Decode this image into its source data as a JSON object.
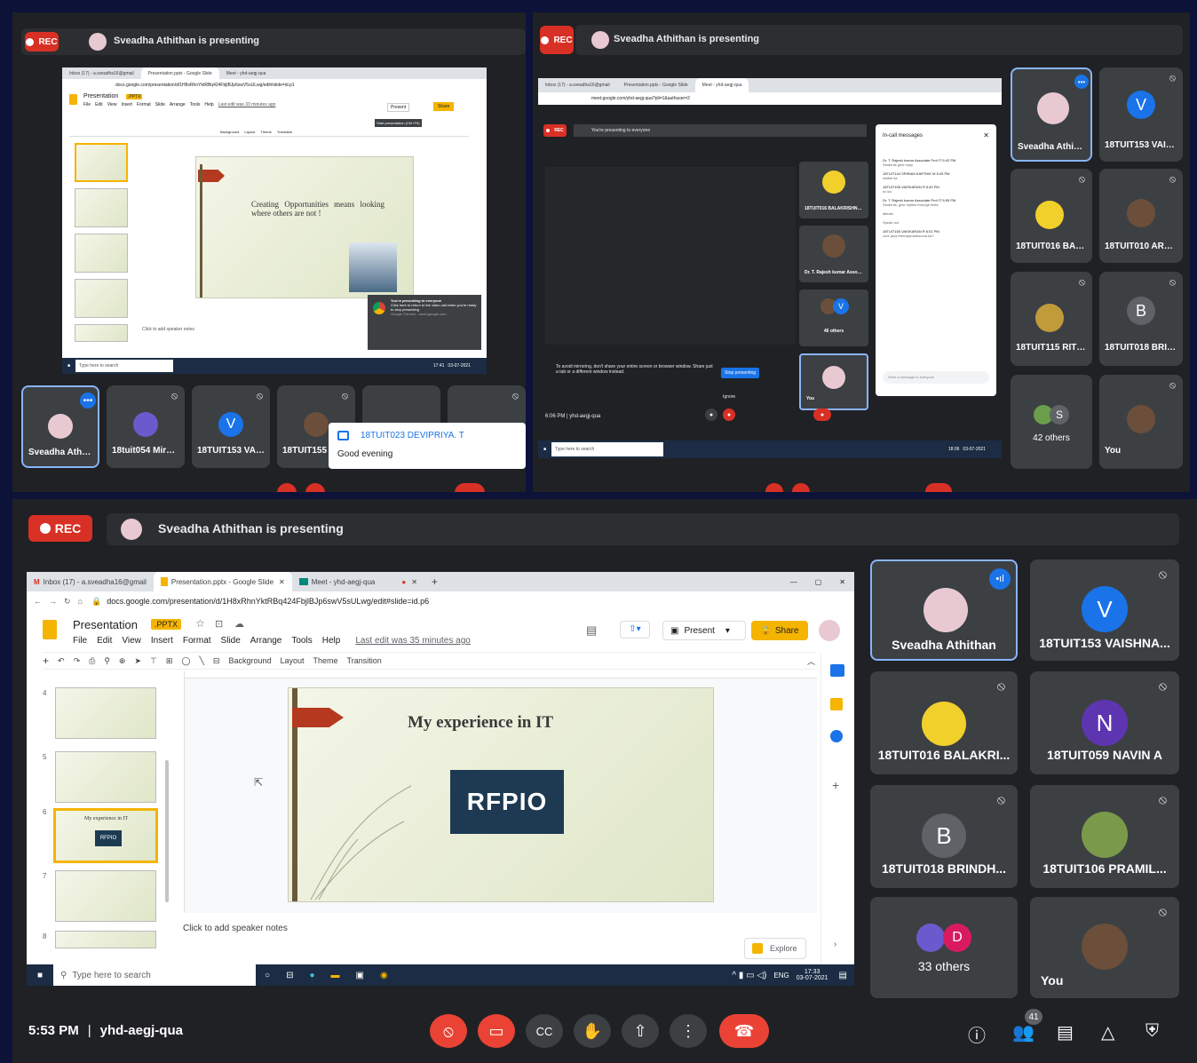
{
  "top_left": {
    "rec_label": "REC",
    "presenting_text": "Sveadha Athithan is presenting",
    "browser": {
      "tabs": [
        "Inbox (17) - a.sveadha16@gmail",
        "Presentation.pptx - Google Slide",
        "Meet - yhd-aegj-qua"
      ],
      "url": "docs.google.com/presentation/d/1H8xRhnYktRBq424FbjlBJp6swV5sULwg/edit#slide=id.p1",
      "doc_title": "Presentation",
      "badge": ".PPTX",
      "menus": [
        "File",
        "Edit",
        "View",
        "Insert",
        "Format",
        "Slide",
        "Arrange",
        "Tools",
        "Help"
      ],
      "last_edit": "Last edit was 33 minutes ago",
      "present_label": "Present",
      "share_label": "Share",
      "tooltip": "Start presentation (Ctrl+F5)",
      "toolbar_items": [
        "Background",
        "Layout",
        "Theme",
        "Transition"
      ],
      "slide_text": "Creating Opportunities means looking where others are not !",
      "speaker_notes": "Click to add speaker notes",
      "popup_title": "You're presenting to everyone",
      "popup_body": "Click here to return to the video call when you're ready to stop presenting",
      "popup_footer": "Google Chrome - meet.google.com",
      "search_placeholder": "Type here to search",
      "time": "17:41",
      "date": "03-07-2021"
    },
    "tiles": [
      "Sveadha Athith...",
      "18tuit054 Mirut...",
      "18TUIT153 VAIS...",
      "18TUIT155 V"
    ],
    "chat_toast": {
      "name": "18TUIT023 DEVIPRIYA. T",
      "message": "Good evening"
    }
  },
  "top_right": {
    "rec_label": "REC",
    "presenting_text": "Sveadha Athithan is presenting",
    "browser": {
      "tabs": [
        "Inbox (17) - a.sveadha16@gmail",
        "Presentation.pptx - Google Slide",
        "Meet - yhd-aegj-qua"
      ],
      "url": "meet.google.com/yhd-aegj-qua?pli=1&authuser=2",
      "presenting_banner": "You're presenting to everyone",
      "mirror_warning": "To avoid mirroring, don't share your entire screen or browser window. Share just a tab or a different window instead.",
      "stop_label": "Stop presenting",
      "ignore_label": "Ignore",
      "inner_tiles": [
        "18TUIT016 BALAKRISHNA...",
        "Dr. T. Rajesh kumar Associ...",
        "46 others",
        "You"
      ],
      "time_code": "6:06 PM | yhd-aegj-qua",
      "search_placeholder": "Type here to search",
      "time": "18:06",
      "date": "03-07-2021",
      "chat": {
        "title": "In-call messages",
        "messages": [
          {
            "from": "Dr. T. Rajesh kumar Associate Prof IT  5:42 PM",
            "text": "Students give reply"
          },
          {
            "from": "18TUIT144 SRIRAM KARTHIK M  5:43 PM",
            "text": "visible ka"
          },
          {
            "from": "18TUIT155 VAISKARAN R  5:49 PM",
            "text": "no ka"
          },
          {
            "from": "Dr. T. Rajesh kumar Associate Prof IT  5:55 PM",
            "text": "Students, give replies through texts"
          },
          {
            "from": "",
            "text": "atleast"
          },
          {
            "from": "",
            "text": "Speak out"
          },
          {
            "from": "18TUIT155 VAISKARAN R  6:02 PM",
            "text": "core java thermjavularisuma ka?"
          }
        ],
        "placeholder": "Send a message to everyone"
      }
    },
    "tiles": [
      "Sveadha Athithan",
      "18TUIT153 VAISHNA...",
      "18TUIT016 BALAKRI...",
      "18TUIT010 ARAVIN...",
      "18TUIT115 RITHIKA...",
      "18TUIT018 BRINDH...",
      "42 others",
      "You"
    ],
    "tile_letters": {
      "vaishna": "V",
      "brindh": "B",
      "others": "S"
    }
  },
  "bottom": {
    "rec_label": "REC",
    "presenting_text": "Sveadha Athithan is presenting",
    "browser": {
      "tabs": [
        "Inbox (17) - a.sveadha16@gmail",
        "Presentation.pptx - Google Slide",
        "Meet - yhd-aegj-qua"
      ],
      "url": "docs.google.com/presentation/d/1H8xRhnYktRBq424FbjlBJp6swV5sULwg/edit#slide=id.p6",
      "doc_title": "Presentation",
      "badge": ".PPTX",
      "menus": [
        "File",
        "Edit",
        "View",
        "Insert",
        "Format",
        "Slide",
        "Arrange",
        "Tools",
        "Help"
      ],
      "last_edit": "Last edit was 35 minutes ago",
      "present_label": "Present",
      "share_label": "Share",
      "toolbar_items": [
        "Background",
        "Layout",
        "Theme",
        "Transition"
      ],
      "slide_numbers": [
        "4",
        "5",
        "6",
        "7",
        "8"
      ],
      "thumb6_title": "My experience in IT",
      "thumb6_logo": "RFPIO",
      "slide_title": "My experience in IT",
      "slide_logo": "RFPIO",
      "speaker_notes": "Click to add speaker notes",
      "explore_label": "Explore",
      "search_placeholder": "Type here to search",
      "lang": "ENG",
      "time": "17:33",
      "date": "03-07-2021"
    },
    "tiles": [
      {
        "name": "Sveadha Athithan",
        "letter": ""
      },
      {
        "name": "18TUIT153 VAISHNA...",
        "letter": "V"
      },
      {
        "name": "18TUIT016 BALAKRI...",
        "letter": ""
      },
      {
        "name": "18TUIT059 NAVIN A",
        "letter": "N"
      },
      {
        "name": "18TUIT018 BRINDH...",
        "letter": "B"
      },
      {
        "name": "18TUIT106 PRAMIL...",
        "letter": ""
      },
      {
        "name": "33 others",
        "letter": "D"
      },
      {
        "name": "You",
        "letter": ""
      }
    ],
    "meeting_time": "5:53 PM",
    "meeting_code": "yhd-aegj-qua",
    "participant_count": "41"
  }
}
